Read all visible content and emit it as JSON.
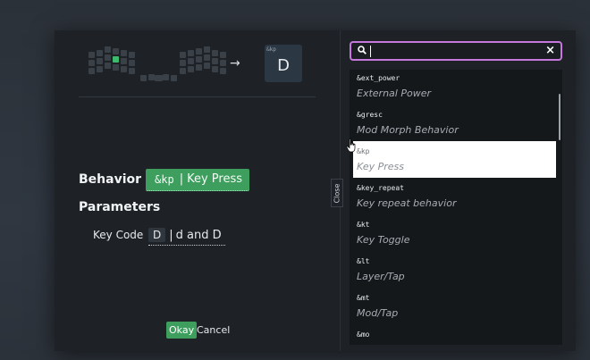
{
  "preview": {
    "code": "&kp",
    "param": "D"
  },
  "arrow": "→",
  "editor": {
    "behavior_label": "Behavior",
    "behavior_code": "&kp",
    "behavior_sep": "|",
    "behavior_name": "Key Press",
    "parameters_label": "Parameters",
    "keycode_label": "Key Code",
    "keycode_chip": "D",
    "keycode_sep": "|",
    "keycode_desc": "d and D"
  },
  "buttons": {
    "okay": "Okay",
    "cancel": "Cancel"
  },
  "close_tab": "Close",
  "search": {
    "value": "",
    "placeholder": "",
    "clear": "×"
  },
  "list": [
    {
      "code": "&ext_power",
      "name": "External Power",
      "selected": false
    },
    {
      "code": "&gresc",
      "name": "Mod Morph Behavior",
      "selected": false
    },
    {
      "code": "&kp",
      "name": "Key Press",
      "selected": true
    },
    {
      "code": "&key_repeat",
      "name": "Key repeat behavior",
      "selected": false
    },
    {
      "code": "&kt",
      "name": "Key Toggle",
      "selected": false
    },
    {
      "code": "&lt",
      "name": "Layer/Tap",
      "selected": false
    },
    {
      "code": "&mt",
      "name": "Mod/Tap",
      "selected": false
    },
    {
      "code": "&mo",
      "name": "",
      "selected": false
    }
  ],
  "colors": {
    "accent_green": "#3d9e5e",
    "search_border": "#c678dd",
    "highlight_key": "#3dba6d"
  }
}
